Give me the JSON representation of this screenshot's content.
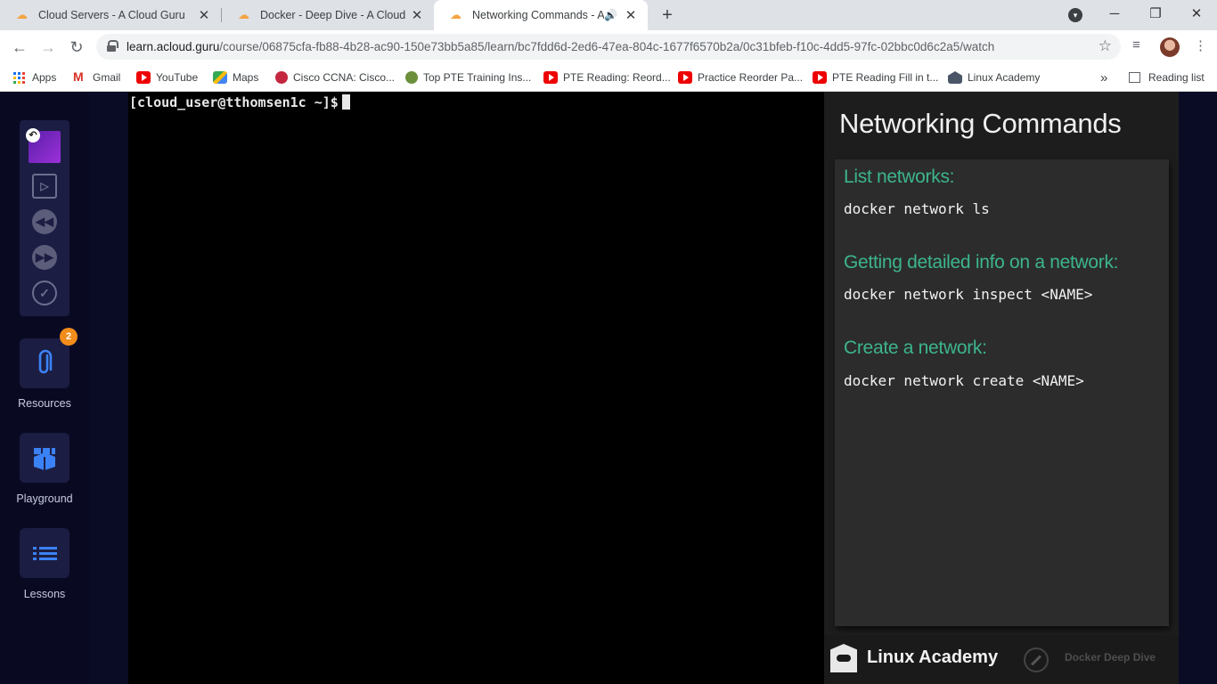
{
  "browser": {
    "tabs": [
      {
        "title": "Cloud Servers - A Cloud Guru",
        "active": false
      },
      {
        "title": "Docker - Deep Dive - A Cloud Gu",
        "active": false
      },
      {
        "title": "Networking Commands - A C",
        "active": true,
        "audio": true
      }
    ],
    "close_glyph": "✕",
    "new_tab_glyph": "+",
    "url_host": "learn.acloud.guru",
    "url_path": "/course/06875cfa-fb88-4b28-ac90-150e73bb5a85/learn/bc7fdd6d-2ed6-47ea-804c-1677f6570b2a/0c31bfeb-f10c-4dd5-97fc-02bbc0d6c2a5/watch",
    "bookmarks": [
      {
        "label": "Apps",
        "icon": "apps-grid-icon"
      },
      {
        "label": "Gmail",
        "icon": "gmail-icon"
      },
      {
        "label": "YouTube",
        "icon": "youtube-icon"
      },
      {
        "label": "Maps",
        "icon": "maps-icon"
      },
      {
        "label": "Cisco CCNA: Cisco...",
        "icon": "cisco-icon"
      },
      {
        "label": "Top PTE Training Ins...",
        "icon": "pte-icon"
      },
      {
        "label": "PTE Reading: Reord...",
        "icon": "youtube-icon"
      },
      {
        "label": "Practice Reorder Pa...",
        "icon": "youtube-icon"
      },
      {
        "label": "PTE Reading Fill in t...",
        "icon": "youtube-icon"
      },
      {
        "label": "Linux Academy",
        "icon": "linux-academy-icon"
      }
    ],
    "overflow_label": "»",
    "reading_list_label": "Reading list"
  },
  "sidebar": {
    "resources_label": "Resources",
    "resources_badge": "2",
    "playground_label": "Playground",
    "lessons_label": "Lessons"
  },
  "terminal": {
    "prompt": "[cloud_user@tthomsen1c ~]$"
  },
  "slide": {
    "title": "Networking Commands",
    "sections": [
      {
        "heading": "List networks:",
        "command": "docker network ls"
      },
      {
        "heading": "Getting detailed info on a network:",
        "command": "docker network inspect <NAME>"
      },
      {
        "heading": "Create a network:",
        "command": "docker network create <NAME>"
      }
    ],
    "footer_brand": "Linux Academy",
    "footer_course": "Docker Deep Dive"
  },
  "colors": {
    "accent_green": "#3cb58e",
    "badge_orange": "#f28c1b",
    "sidebar_bg": "#090a22"
  }
}
